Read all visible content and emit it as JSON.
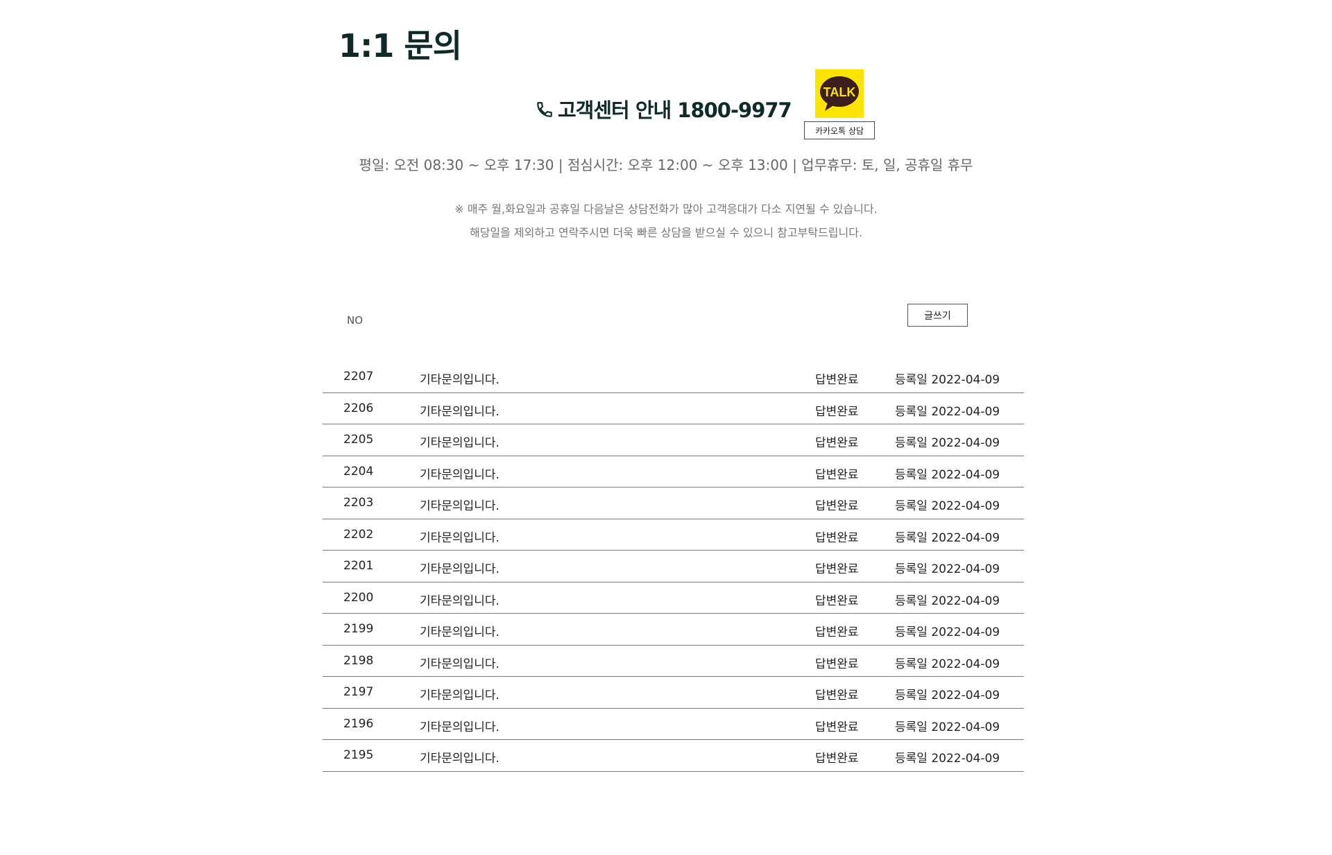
{
  "page": {
    "title": "1:1 문의"
  },
  "contact": {
    "phone_icon": "phone-icon",
    "label": "고객센터 안내 1800-9977",
    "kakao_logo_text": "TALK",
    "kakao_button": "카카오톡 상담",
    "hours": "평일: 오전 08:30 ~ 오후 17:30  | 점심시간: 오후 12:00 ~ 오후 13:00  | 업무휴무: 토, 일, 공휴일 휴무",
    "notice_line1": "※ 매주 월,화요일과 공휴일 다음날은 상담전화가 많아 고객응대가 다소 지연될 수 있습니다.",
    "notice_line2": "해당일을 제외하고 연락주시면 더욱 빠른 상담을 받으실 수 있으니 참고부탁드립니다."
  },
  "board": {
    "no_header": "NO",
    "write_button": "글쓰기",
    "rows": [
      {
        "no": "2207",
        "title": "기타문의입니다.",
        "status": "답변완료",
        "date": "등록일 2022-04-09"
      },
      {
        "no": "2206",
        "title": "기타문의입니다.",
        "status": "답변완료",
        "date": "등록일 2022-04-09"
      },
      {
        "no": "2205",
        "title": "기타문의입니다.",
        "status": "답변완료",
        "date": "등록일 2022-04-09"
      },
      {
        "no": "2204",
        "title": "기타문의입니다.",
        "status": "답변완료",
        "date": "등록일 2022-04-09"
      },
      {
        "no": "2203",
        "title": "기타문의입니다.",
        "status": "답변완료",
        "date": "등록일 2022-04-09"
      },
      {
        "no": "2202",
        "title": "기타문의입니다.",
        "status": "답변완료",
        "date": "등록일 2022-04-09"
      },
      {
        "no": "2201",
        "title": "기타문의입니다.",
        "status": "답변완료",
        "date": "등록일 2022-04-09"
      },
      {
        "no": "2200",
        "title": "기타문의입니다.",
        "status": "답변완료",
        "date": "등록일 2022-04-09"
      },
      {
        "no": "2199",
        "title": "기타문의입니다.",
        "status": "답변완료",
        "date": "등록일 2022-04-09"
      },
      {
        "no": "2198",
        "title": "기타문의입니다.",
        "status": "답변완료",
        "date": "등록일 2022-04-09"
      },
      {
        "no": "2197",
        "title": "기타문의입니다.",
        "status": "답변완료",
        "date": "등록일 2022-04-09"
      },
      {
        "no": "2196",
        "title": "기타문의입니다.",
        "status": "답변완료",
        "date": "등록일 2022-04-09"
      },
      {
        "no": "2195",
        "title": "기타문의입니다.",
        "status": "답변완료",
        "date": "등록일 2022-04-09"
      }
    ]
  }
}
